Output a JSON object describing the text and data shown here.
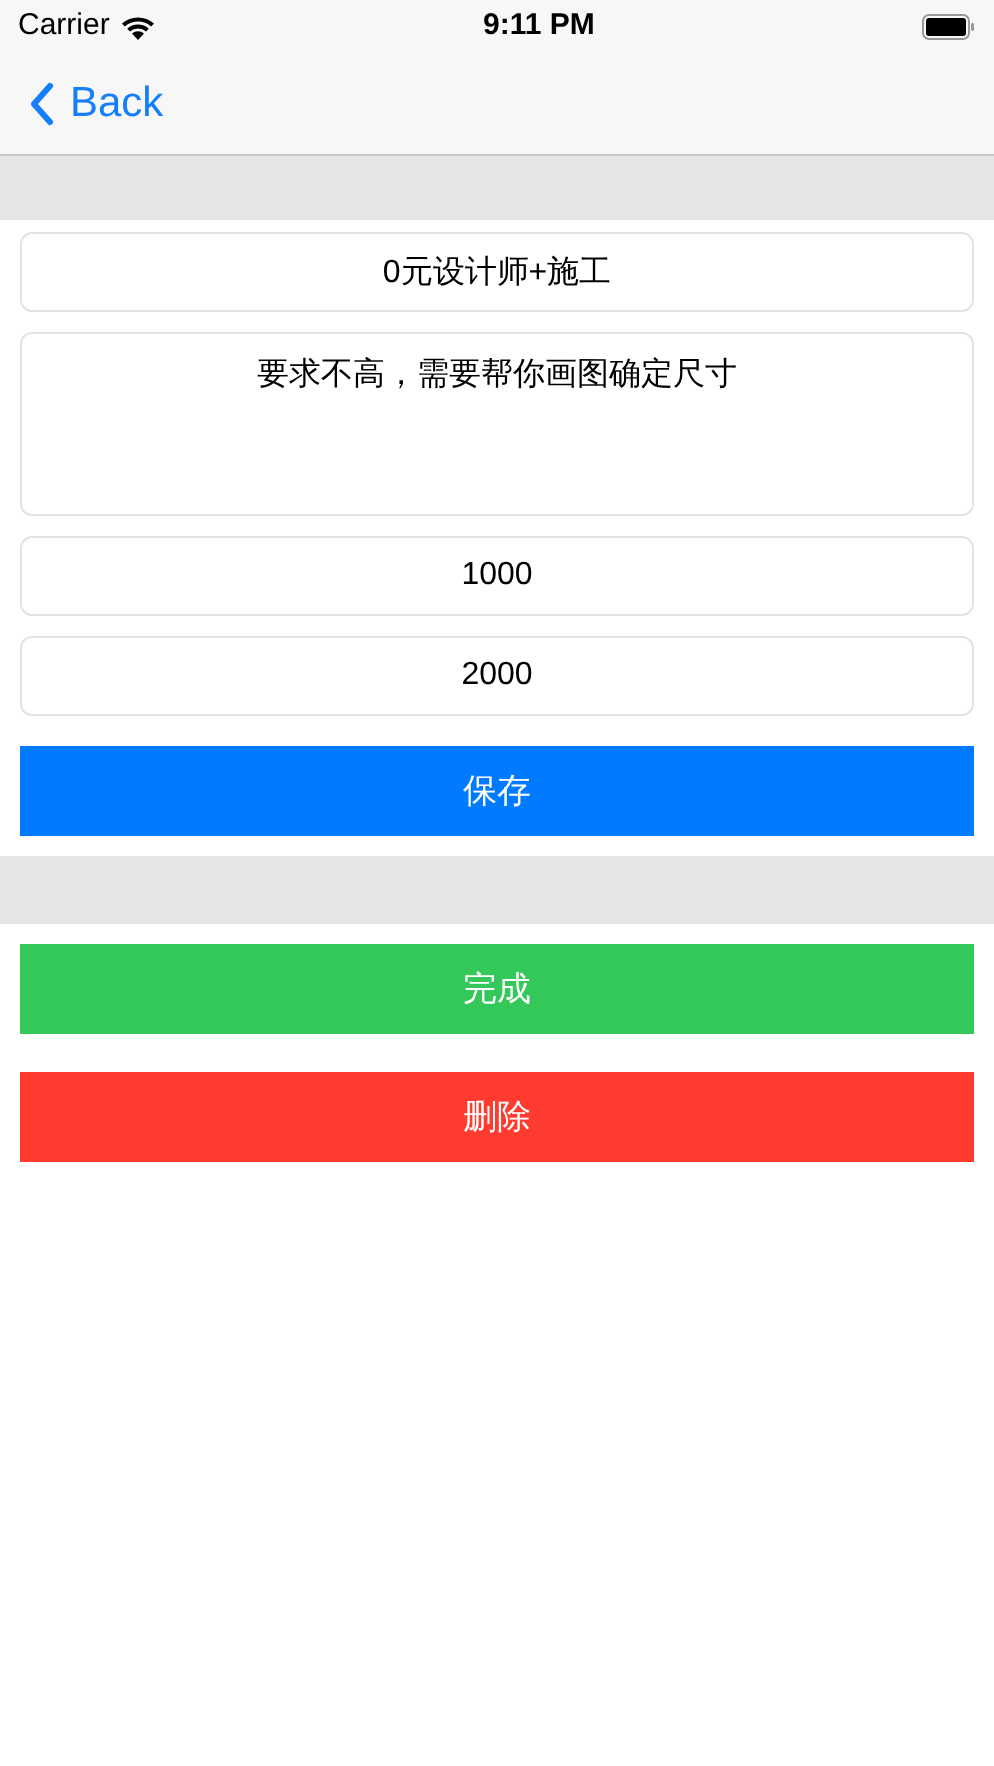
{
  "status_bar": {
    "carrier": "Carrier",
    "time": "9:11 PM"
  },
  "nav": {
    "back": "Back"
  },
  "fields": [
    {
      "kind": "line",
      "value": "0元设计师+施工"
    },
    {
      "kind": "area",
      "value": "要求不高，需要帮你画图确定尺寸"
    },
    {
      "kind": "line",
      "value": "1000"
    },
    {
      "kind": "line",
      "value": "2000"
    }
  ],
  "save_button": {
    "label": "保存",
    "color": "#007aff"
  },
  "actions": [
    {
      "label": "完成",
      "color": "#34c759"
    },
    {
      "label": "删除",
      "color": "#ff3b30"
    }
  ]
}
